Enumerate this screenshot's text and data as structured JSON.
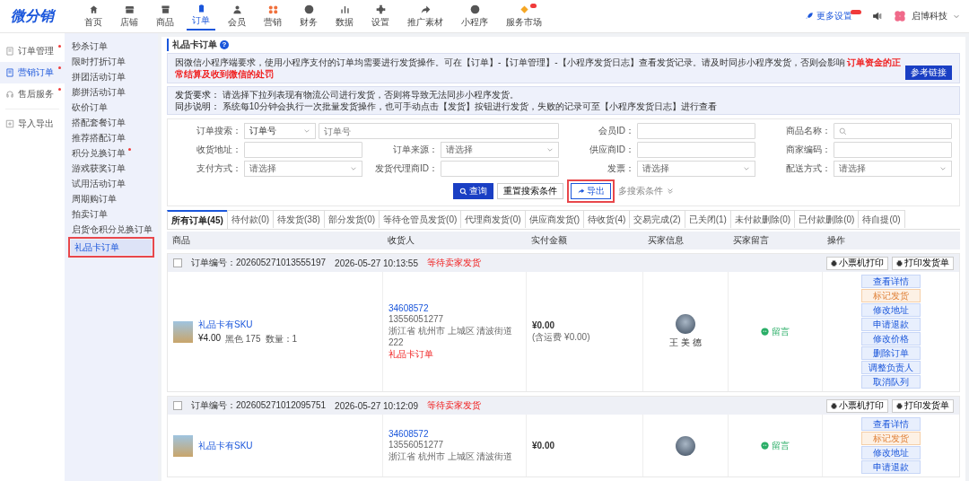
{
  "logo": "微分销",
  "nav": {
    "items": [
      {
        "label": "首页",
        "selected": false,
        "badge": false
      },
      {
        "label": "店铺",
        "selected": false,
        "badge": false
      },
      {
        "label": "商品",
        "selected": false,
        "badge": false
      },
      {
        "label": "订单",
        "selected": true,
        "badge": false
      },
      {
        "label": "会员",
        "selected": false,
        "badge": false
      },
      {
        "label": "营销",
        "selected": false,
        "badge": false
      },
      {
        "label": "财务",
        "selected": false,
        "badge": false
      },
      {
        "label": "数据",
        "selected": false,
        "badge": false
      },
      {
        "label": "设置",
        "selected": false,
        "badge": false
      },
      {
        "label": "推广素材",
        "selected": false,
        "badge": false
      },
      {
        "label": "小程序",
        "selected": false,
        "badge": false
      },
      {
        "label": "服务市场",
        "selected": false,
        "badge": true
      }
    ],
    "more_settings": "更多设置",
    "user": "启博科技"
  },
  "sidebar": {
    "groups": [
      [
        {
          "label": "订单管理",
          "selected": false,
          "dot": true
        },
        {
          "label": "营销订单",
          "selected": true,
          "dot": true
        },
        {
          "label": "售后服务",
          "selected": false,
          "dot": true
        }
      ],
      [
        {
          "label": "导入导出",
          "selected": false,
          "dot": false
        }
      ]
    ]
  },
  "submenu": {
    "items": [
      {
        "label": "秒杀订单",
        "selected": false,
        "dot": false,
        "highlighted": false
      },
      {
        "label": "限时打折订单",
        "selected": false,
        "dot": false,
        "highlighted": false
      },
      {
        "label": "拼团活动订单",
        "selected": false,
        "dot": false,
        "highlighted": false
      },
      {
        "label": "膨拼活动订单",
        "selected": false,
        "dot": false,
        "highlighted": false
      },
      {
        "label": "砍价订单",
        "selected": false,
        "dot": false,
        "highlighted": false
      },
      {
        "label": "搭配套餐订单",
        "selected": false,
        "dot": false,
        "highlighted": false
      },
      {
        "label": "推荐搭配订单",
        "selected": false,
        "dot": false,
        "highlighted": false
      },
      {
        "label": "积分兑换订单",
        "selected": false,
        "dot": true,
        "highlighted": false
      },
      {
        "label": "游戏获奖订单",
        "selected": false,
        "dot": false,
        "highlighted": false
      },
      {
        "label": "试用活动订单",
        "selected": false,
        "dot": false,
        "highlighted": false
      },
      {
        "label": "周期购订单",
        "selected": false,
        "dot": false,
        "highlighted": false
      },
      {
        "label": "拍卖订单",
        "selected": false,
        "dot": false,
        "highlighted": false
      },
      {
        "label": "启货仓积分兑换订单",
        "selected": false,
        "dot": false,
        "highlighted": false
      },
      {
        "label": "礼品卡订单",
        "selected": true,
        "dot": false,
        "highlighted": true
      }
    ]
  },
  "page": {
    "title": "礼品卡订单",
    "help": "?"
  },
  "notice": {
    "text": "因微信小程序端要求，使用小程序支付的订单均需要进行发货操作。可在【订单】-【订单管理】-【小程序发货日志】查看发货记录。请及时同步小程序发货，否则会影响 **订单资金的正常结算及收到微信的处罚**",
    "button": "参考链接"
  },
  "shipping_notes": [
    "**发货要求：** 请选择下拉列表现有物流公司进行发货，否则将导致无法同步小程序发货。",
    "**同步说明：** 系统每10分钟会执行一次批量发货操作，也可手动点击【发货】按钮进行发货，失败的记录可至【小程序发货日志】进行查看"
  ],
  "filters": [
    {
      "label": "订单搜索：",
      "kind": "select_input",
      "value": "订单号",
      "placeholder": "订单号"
    },
    {
      "label": "会员ID：",
      "kind": "input"
    },
    {
      "label": "商品名称：",
      "kind": "search"
    },
    {
      "label": "收货地址：",
      "kind": "input"
    },
    {
      "label": "订单来源：",
      "kind": "select",
      "placeholder": "请选择"
    },
    {
      "label": "供应商ID：",
      "kind": "input"
    },
    {
      "label": "商家编码：",
      "kind": "input"
    },
    {
      "label": "支付方式：",
      "kind": "select",
      "placeholder": "请选择"
    },
    {
      "label": "发货代理商ID：",
      "kind": "input"
    },
    {
      "label": "发票：",
      "kind": "select",
      "placeholder": "请选择"
    },
    {
      "label": "配送方式：",
      "kind": "select",
      "placeholder": "请选择"
    }
  ],
  "filter_buttons": [
    {
      "label": "查询",
      "kind": "primary",
      "highlighted": false
    },
    {
      "label": "重置搜索条件",
      "kind": "default",
      "highlighted": false
    },
    {
      "label": "导出",
      "kind": "export",
      "highlighted": true
    }
  ],
  "more_filters": "多搜索条件",
  "tabs": [
    {
      "label": "所有订单(45)",
      "selected": true
    },
    {
      "label": "待付款(0)",
      "selected": false
    },
    {
      "label": "待发货(38)",
      "selected": false
    },
    {
      "label": "部分发货(0)",
      "selected": false
    },
    {
      "label": "等待仓管员发货(0)",
      "selected": false
    },
    {
      "label": "代理商发货(0)",
      "selected": false
    },
    {
      "label": "供应商发货()",
      "selected": false
    },
    {
      "label": "待收货(4)",
      "selected": false
    },
    {
      "label": "交易完成(2)",
      "selected": false
    },
    {
      "label": "已关闭(1)",
      "selected": false
    },
    {
      "label": "未付款删除(0)",
      "selected": false
    },
    {
      "label": "已付款删除(0)",
      "selected": false
    },
    {
      "label": "待自提(0)",
      "selected": false
    }
  ],
  "table": {
    "columns": [
      "商品",
      "收货人",
      "实付金额",
      "买家信息",
      "买家留言",
      "操作"
    ],
    "orders": [
      {
        "checked": false,
        "number": "订单编号：202605271013555197",
        "time": "2026-05-27 10:13:55",
        "status": "等待卖家发货",
        "print_buttons": [
          "小票机打印",
          "打印发货单"
        ],
        "product": {
          "name": "礼品卡有SKU",
          "price": "¥4.00",
          "spec": "黑色 175",
          "qty": "数量：1"
        },
        "consignee": {
          "id": "34608572",
          "phone": "13556051277",
          "address": "浙江省 杭州市 上城区 清波街道 222",
          "tag": "礼品卡订单"
        },
        "paid": {
          "amount": "¥0.00",
          "note": "(含运费 ¥0.00)"
        },
        "buyer": "王 美 德",
        "message": "留言",
        "actions": [
          {
            "label": "查看详情",
            "kind": "default"
          },
          {
            "label": "标记发货",
            "kind": "warning"
          },
          {
            "label": "修改地址",
            "kind": "default"
          },
          {
            "label": "申请退款",
            "kind": "default"
          },
          {
            "label": "修改价格",
            "kind": "default"
          },
          {
            "label": "删除订单",
            "kind": "default"
          },
          {
            "label": "调整负责人",
            "kind": "default"
          },
          {
            "label": "取消队列",
            "kind": "default"
          }
        ]
      },
      {
        "checked": false,
        "number": "订单编号：202605271012095751",
        "time": "2026-05-27 10:12:09",
        "status": "等待卖家发货",
        "print_buttons": [
          "小票机打印",
          "打印发货单"
        ],
        "product": {
          "name": "礼品卡有SKU"
        },
        "consignee": {
          "id": "34608572",
          "phone": "13556051277",
          "address": "浙江省 杭州市 上城区 清波街道"
        },
        "paid": {
          "amount": "¥0.00"
        },
        "message": "留言",
        "actions": [
          {
            "label": "查看详情",
            "kind": "default"
          },
          {
            "label": "标记发货",
            "kind": "warning"
          },
          {
            "label": "修改地址",
            "kind": "default"
          },
          {
            "label": "申请退款",
            "kind": "default"
          }
        ]
      }
    ]
  }
}
